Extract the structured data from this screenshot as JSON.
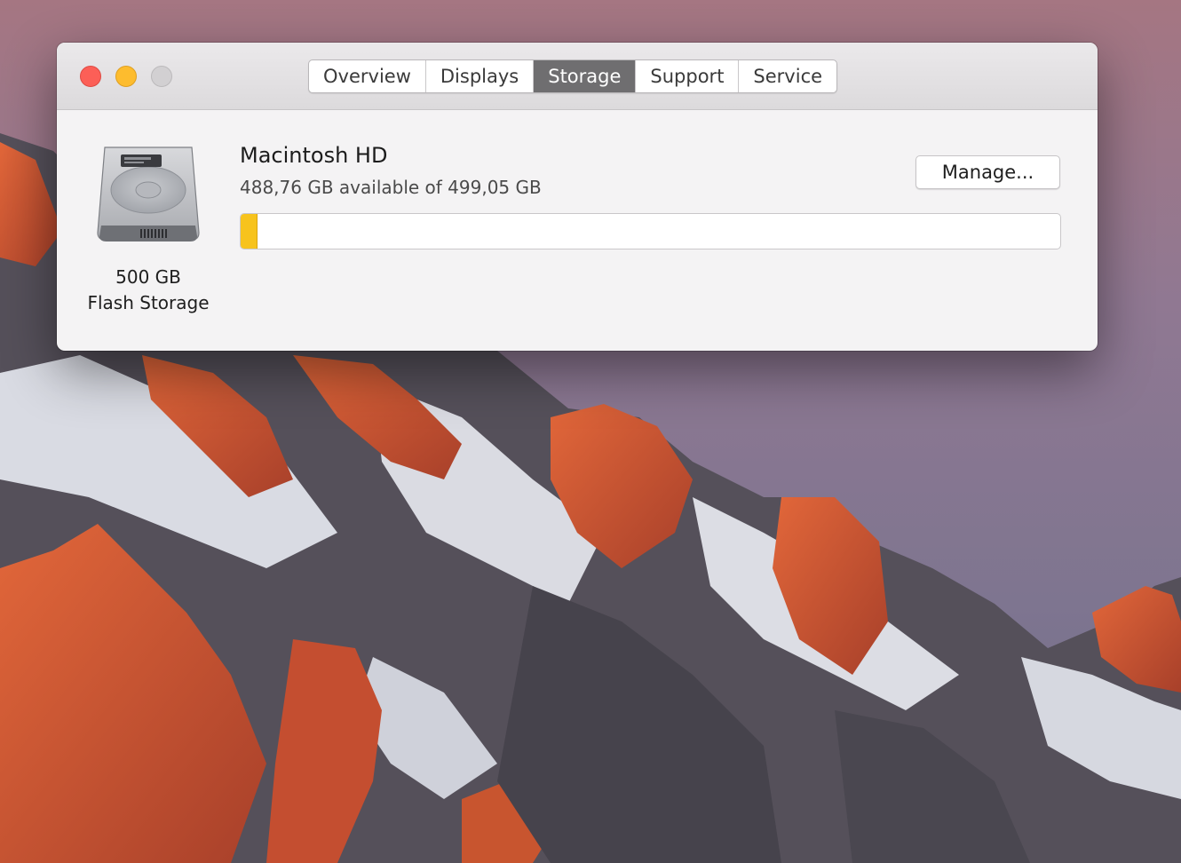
{
  "window": {
    "tabs": [
      {
        "label": "Overview",
        "active": false
      },
      {
        "label": "Displays",
        "active": false
      },
      {
        "label": "Storage",
        "active": true
      },
      {
        "label": "Support",
        "active": false
      },
      {
        "label": "Service",
        "active": false
      }
    ],
    "traffic_lights": [
      "close",
      "minimize",
      "zoom"
    ]
  },
  "disk": {
    "icon": "hard-drive-icon",
    "capacity": "500 GB",
    "type": "Flash Storage"
  },
  "volume": {
    "name": "Macintosh HD",
    "info": "488,76 GB available of 499,05 GB",
    "used_fraction": 0.0206,
    "used_color": "#f7c31c"
  },
  "actions": {
    "manage_label": "Manage..."
  }
}
